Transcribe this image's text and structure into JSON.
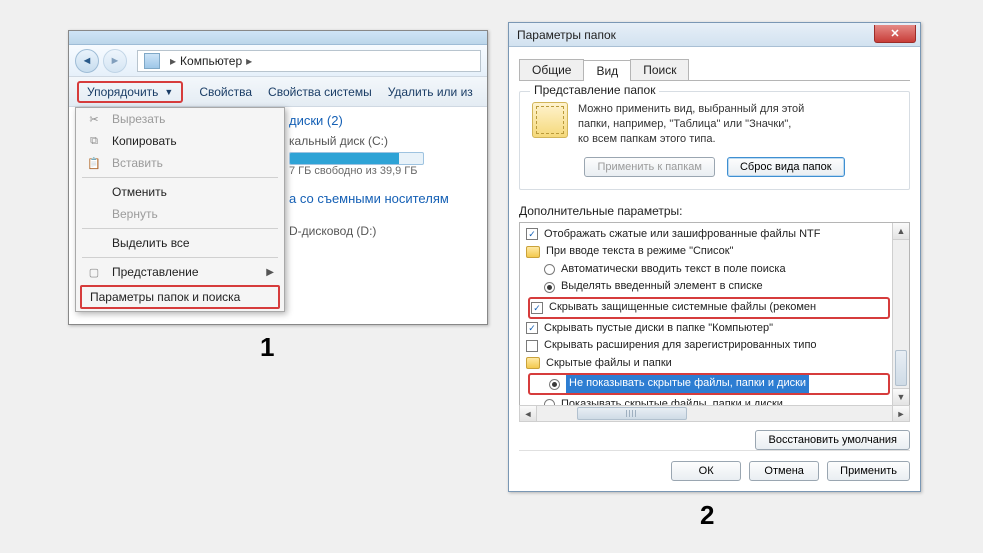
{
  "win1": {
    "breadcrumb": {
      "root_glyph": "▸",
      "item": "Компьютер",
      "sep": "▸"
    },
    "toolbar": {
      "organize": "Упорядочить",
      "properties": "Свойства",
      "system_properties": "Свойства системы",
      "uninstall": "Удалить или из"
    },
    "menu": {
      "cut": "Вырезать",
      "copy": "Копировать",
      "paste": "Вставить",
      "undo": "Отменить",
      "redo": "Вернуть",
      "select_all": "Выделить все",
      "layout": "Представление",
      "folder_options": "Параметры папок и поиска"
    },
    "content": {
      "disks_header": "диски (2)",
      "drive_c": "кальный диск (C:)",
      "drive_c_free": "7 ГБ свободно из 39,9 ГБ",
      "removable_header": "а со съемными носителям",
      "dvd": "D-дисковод (D:)"
    }
  },
  "label1": "1",
  "win2": {
    "title": "Параметры папок",
    "tabs": {
      "general": "Общие",
      "view": "Вид",
      "search": "Поиск"
    },
    "group": {
      "legend": "Представление папок",
      "text1": "Можно применить вид, выбранный для этой",
      "text2": "папки, например, \"Таблица\" или \"Значки\",",
      "text3": "ко всем папкам этого типа.",
      "apply": "Применить к папкам",
      "reset": "Сброс вида папок"
    },
    "adv_label": "Дополнительные параметры:",
    "tree": {
      "r1": "Отображать сжатые или зашифрованные файлы NTF",
      "r2": "При вводе текста в режиме \"Список\"",
      "r3": "Автоматически вводить текст в поле поиска",
      "r4": "Выделять введенный элемент в списке",
      "r5": "Скрывать защищенные системные файлы (рекомен",
      "r6": "Скрывать пустые диски в папке \"Компьютер\"",
      "r7": "Скрывать расширения для зарегистрированных типо",
      "r8": "Скрытые файлы и папки",
      "r9": "Не показывать скрытые файлы, папки и диски",
      "r10": "Показывать скрытые файлы, папки и диски"
    },
    "restore": "Восстановить умолчания",
    "buttons": {
      "ok": "ОК",
      "cancel": "Отмена",
      "apply": "Применить"
    }
  },
  "label2": "2"
}
